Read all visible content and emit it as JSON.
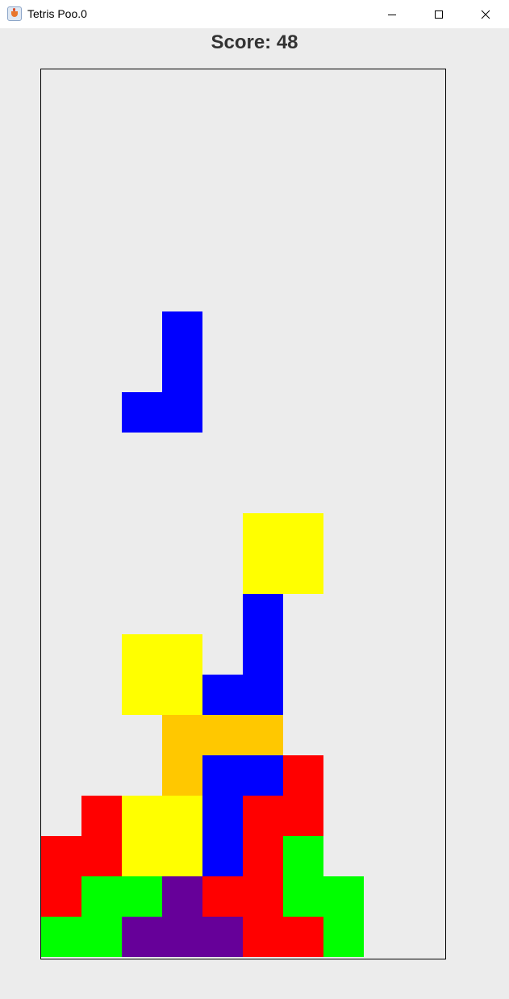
{
  "window": {
    "title": "Tetris Poo.0",
    "icon": "java-app-icon",
    "controls": {
      "minimize_icon": "minimize-icon",
      "maximize_icon": "maximize-icon",
      "close_icon": "close-icon"
    }
  },
  "score": {
    "text": "Score: 48",
    "value": 48
  },
  "board": {
    "columns": 10,
    "rows": 22,
    "colors": {
      "T": "#660099",
      "blue": "#0000ff",
      "red": "#ff0000",
      "yellow": "#ffff00",
      "green": "#00ff00",
      "orange": "#ffc800"
    },
    "falling_piece": {
      "shape": "J",
      "color": "blue",
      "cells": [
        [
          3,
          6
        ],
        [
          3,
          7
        ],
        [
          3,
          8
        ],
        [
          2,
          8
        ]
      ]
    },
    "settled_cells": [
      {
        "col": 5,
        "row": 11,
        "color": "yellow"
      },
      {
        "col": 6,
        "row": 11,
        "color": "yellow"
      },
      {
        "col": 5,
        "row": 12,
        "color": "yellow"
      },
      {
        "col": 6,
        "row": 12,
        "color": "yellow"
      },
      {
        "col": 5,
        "row": 13,
        "color": "blue"
      },
      {
        "col": 5,
        "row": 14,
        "color": "blue"
      },
      {
        "col": 5,
        "row": 15,
        "color": "blue"
      },
      {
        "col": 4,
        "row": 15,
        "color": "blue"
      },
      {
        "col": 2,
        "row": 14,
        "color": "yellow"
      },
      {
        "col": 3,
        "row": 14,
        "color": "yellow"
      },
      {
        "col": 2,
        "row": 15,
        "color": "yellow"
      },
      {
        "col": 3,
        "row": 15,
        "color": "yellow"
      },
      {
        "col": 3,
        "row": 16,
        "color": "orange"
      },
      {
        "col": 4,
        "row": 16,
        "color": "orange"
      },
      {
        "col": 5,
        "row": 16,
        "color": "orange"
      },
      {
        "col": 3,
        "row": 17,
        "color": "orange"
      },
      {
        "col": 4,
        "row": 17,
        "color": "blue"
      },
      {
        "col": 5,
        "row": 17,
        "color": "blue"
      },
      {
        "col": 4,
        "row": 18,
        "color": "blue"
      },
      {
        "col": 4,
        "row": 19,
        "color": "blue"
      },
      {
        "col": 6,
        "row": 17,
        "color": "red"
      },
      {
        "col": 5,
        "row": 18,
        "color": "red"
      },
      {
        "col": 6,
        "row": 18,
        "color": "red"
      },
      {
        "col": 5,
        "row": 19,
        "color": "red"
      },
      {
        "col": 1,
        "row": 18,
        "color": "red"
      },
      {
        "col": 0,
        "row": 19,
        "color": "red"
      },
      {
        "col": 1,
        "row": 19,
        "color": "red"
      },
      {
        "col": 0,
        "row": 20,
        "color": "red"
      },
      {
        "col": 2,
        "row": 18,
        "color": "yellow"
      },
      {
        "col": 3,
        "row": 18,
        "color": "yellow"
      },
      {
        "col": 2,
        "row": 19,
        "color": "yellow"
      },
      {
        "col": 3,
        "row": 19,
        "color": "yellow"
      },
      {
        "col": 6,
        "row": 19,
        "color": "green"
      },
      {
        "col": 6,
        "row": 20,
        "color": "green"
      },
      {
        "col": 7,
        "row": 20,
        "color": "green"
      },
      {
        "col": 7,
        "row": 21,
        "color": "green"
      },
      {
        "col": 1,
        "row": 20,
        "color": "green"
      },
      {
        "col": 2,
        "row": 20,
        "color": "green"
      },
      {
        "col": 0,
        "row": 21,
        "color": "green"
      },
      {
        "col": 1,
        "row": 21,
        "color": "green"
      },
      {
        "col": 3,
        "row": 20,
        "color": "T"
      },
      {
        "col": 2,
        "row": 21,
        "color": "T"
      },
      {
        "col": 3,
        "row": 21,
        "color": "T"
      },
      {
        "col": 4,
        "row": 21,
        "color": "T"
      },
      {
        "col": 4,
        "row": 20,
        "color": "red"
      },
      {
        "col": 5,
        "row": 20,
        "color": "red"
      },
      {
        "col": 5,
        "row": 21,
        "color": "red"
      },
      {
        "col": 6,
        "row": 21,
        "color": "red"
      }
    ]
  }
}
